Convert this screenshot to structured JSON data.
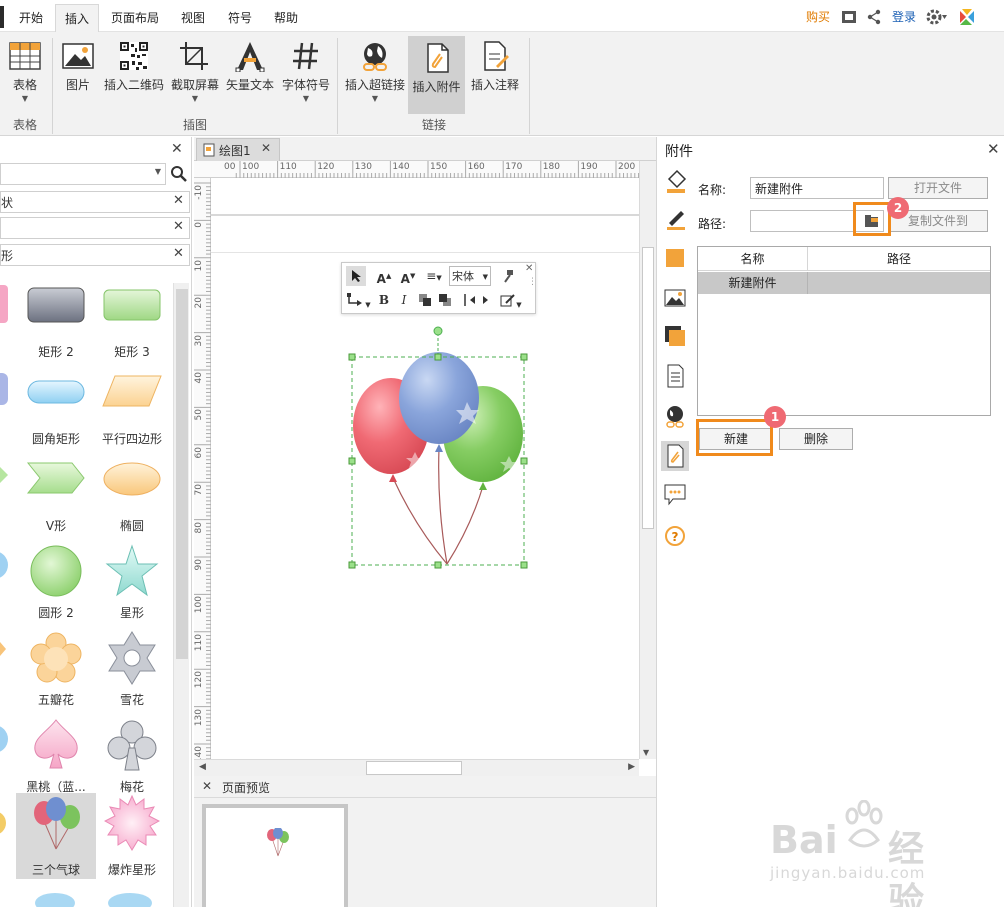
{
  "menu": {
    "tabs": [
      {
        "label": "开始"
      },
      {
        "label": "插入"
      },
      {
        "label": "页面布局"
      },
      {
        "label": "视图"
      },
      {
        "label": "符号"
      },
      {
        "label": "帮助"
      }
    ],
    "buy": "购买",
    "login": "登录"
  },
  "ribbon": {
    "table": {
      "label": "表格",
      "group": "表格"
    },
    "image": {
      "label": "图片"
    },
    "qrcode": {
      "label": "插入二维码"
    },
    "screenshot": {
      "label": "截取屏幕"
    },
    "vector_text": {
      "label": "矢量文本"
    },
    "font_symbol": {
      "label": "字体符号"
    },
    "illustration_group": "插图",
    "hyperlink": {
      "label": "插入超链接"
    },
    "attachment": {
      "label": "插入附件"
    },
    "note": {
      "label": "插入注释"
    },
    "link_group": "链接"
  },
  "left_panel": {
    "section1": "状",
    "section2": "形",
    "shapes": [
      {
        "label": "矩形 2"
      },
      {
        "label": "矩形 3"
      },
      {
        "label": "圆角矩形"
      },
      {
        "label": "平行四边形"
      },
      {
        "label": "V形"
      },
      {
        "label": "椭圆"
      },
      {
        "label": "圆形 2"
      },
      {
        "label": "星形"
      },
      {
        "label": "五瓣花"
      },
      {
        "label": "雪花"
      },
      {
        "label": "黑桃（蓝..."
      },
      {
        "label": "梅花"
      },
      {
        "label": "三个气球"
      },
      {
        "label": "爆炸星形"
      }
    ]
  },
  "canvas": {
    "doc_tab": "绘图1",
    "ruler_h": [
      "00",
      "100",
      "110",
      "120",
      "130",
      "140",
      "150",
      "160",
      "170",
      "180",
      "190",
      "200"
    ],
    "ruler_v": [
      "-10",
      "0",
      "10",
      "20",
      "30",
      "40",
      "50",
      "60",
      "70",
      "80",
      "90",
      "100",
      "110",
      "120",
      "130",
      "140"
    ],
    "toolbar_font": "宋体",
    "preview_title": "页面预览"
  },
  "attachment_panel": {
    "title": "附件",
    "name_label": "名称:",
    "name_value": "新建附件",
    "path_label": "路径:",
    "path_value": "",
    "open_file": "打开文件",
    "copy_file_to": "复制文件到",
    "grid_headers": [
      "名称",
      "路径"
    ],
    "rows": [
      {
        "name": "新建附件",
        "path": ""
      }
    ],
    "new_button": "新建",
    "delete_button": "删除",
    "badge1": "1",
    "badge2": "2"
  },
  "watermark": {
    "brand": "Bai",
    "brand2": "经验",
    "url": "jingyan.baidu.com"
  },
  "colors": {
    "accent_orange": "#F08A1C",
    "badge_red": "#EF6A73",
    "buy_orange": "#E07B00",
    "login_blue": "#1A5FB4"
  }
}
